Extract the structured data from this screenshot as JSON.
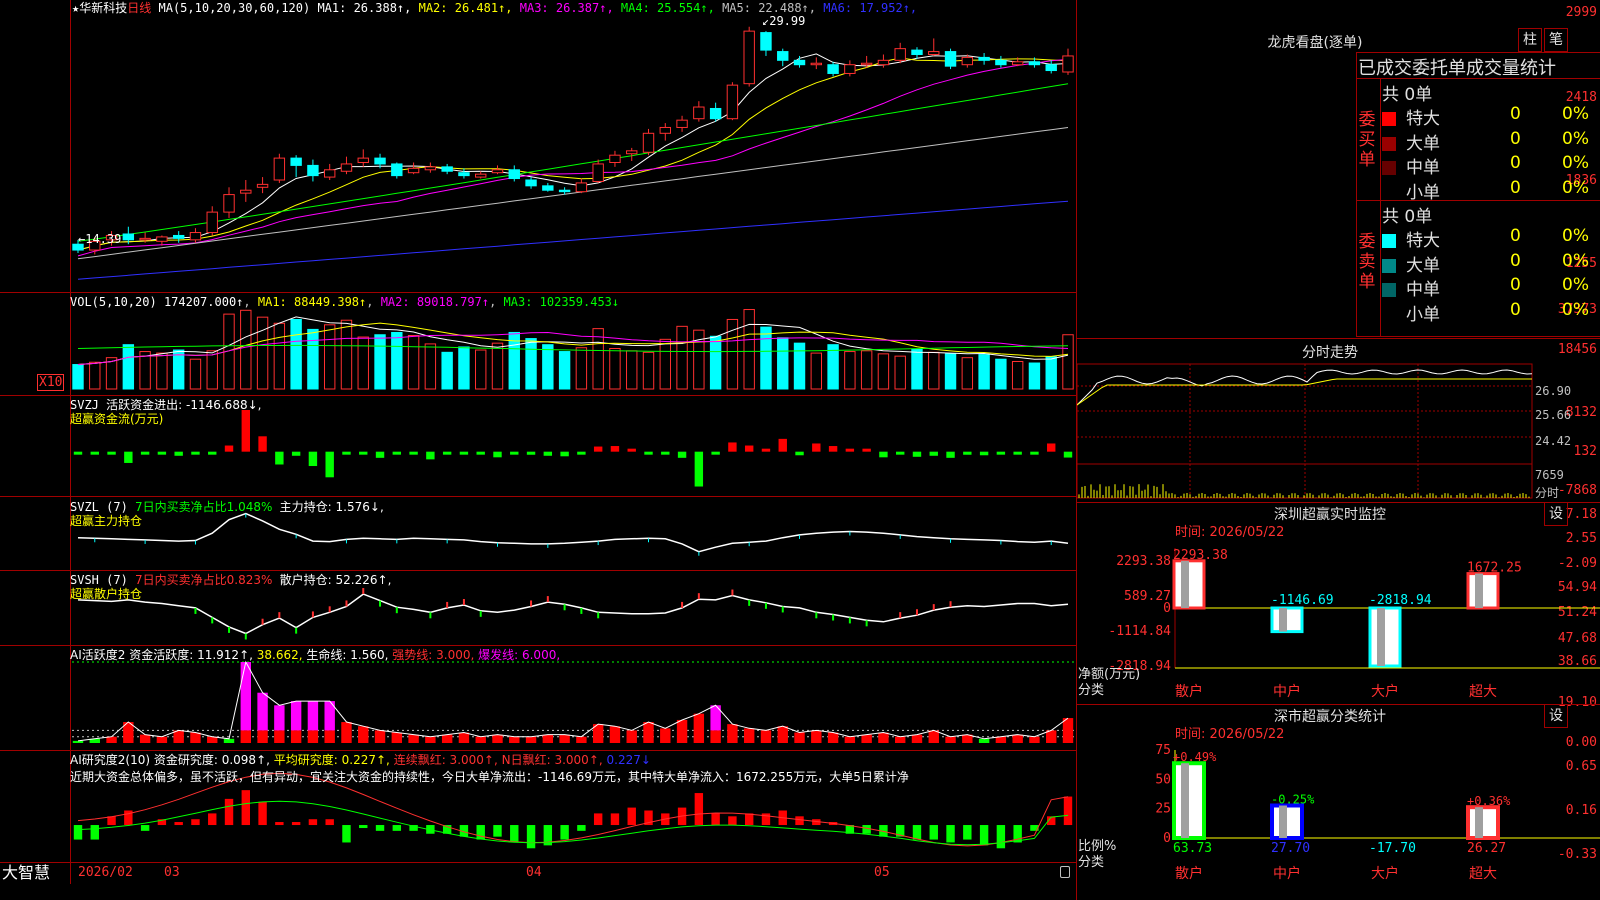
{
  "stock": {
    "star": "★",
    "name": "华新科技",
    "period": "日线"
  },
  "kline": {
    "ma_label": "MA(5,10,20,30,60,120)",
    "mas": [
      {
        "t": "MA1: 26.388↑",
        "c": "#ffffff"
      },
      {
        "t": "MA2: 26.481↑",
        "c": "#ffff00"
      },
      {
        "t": "MA3: 26.387↑",
        "c": "#ff00ff"
      },
      {
        "t": "MA4: 25.554↑",
        "c": "#00ff00"
      },
      {
        "t": "MA5: 22.488↑",
        "c": "#c0c0c0"
      },
      {
        "t": "MA6: 17.952↑",
        "c": "#3030ff"
      }
    ],
    "yticks": [
      "2999",
      "2418",
      "1836",
      "1255"
    ],
    "high_mark": "29.99",
    "low_mark": "14.39",
    "candles": [
      [
        15.0,
        14.6,
        15.3,
        14.4
      ],
      [
        14.6,
        15.2,
        15.5,
        14.3
      ],
      [
        15.3,
        15.6,
        15.9,
        14.9
      ],
      [
        15.7,
        15.3,
        16.2,
        15.0
      ],
      [
        15.3,
        15.4,
        15.8,
        15.1
      ],
      [
        15.2,
        15.5,
        15.6,
        14.9
      ],
      [
        15.6,
        15.4,
        15.9,
        15.1
      ],
      [
        15.3,
        15.8,
        16.1,
        15.1
      ],
      [
        15.8,
        17.2,
        17.6,
        15.6
      ],
      [
        17.2,
        18.4,
        18.9,
        16.8
      ],
      [
        18.5,
        18.7,
        19.4,
        17.9
      ],
      [
        18.9,
        19.1,
        19.6,
        18.5
      ],
      [
        19.4,
        20.9,
        21.2,
        19.2
      ],
      [
        20.9,
        20.4,
        21.1,
        19.6
      ],
      [
        20.4,
        19.7,
        20.8,
        19.3
      ],
      [
        19.6,
        20.1,
        20.5,
        19.4
      ],
      [
        20.0,
        20.5,
        21.0,
        19.8
      ],
      [
        20.6,
        20.9,
        21.5,
        20.3
      ],
      [
        20.9,
        20.5,
        21.2,
        20.2
      ],
      [
        20.5,
        19.7,
        20.6,
        19.5
      ],
      [
        19.9,
        20.2,
        20.6,
        19.8
      ],
      [
        20.1,
        20.3,
        20.6,
        19.9
      ],
      [
        20.3,
        20.0,
        20.5,
        19.8
      ],
      [
        19.9,
        19.7,
        20.2,
        19.5
      ],
      [
        19.6,
        19.8,
        20.0,
        19.5
      ],
      [
        19.9,
        20.1,
        20.4,
        19.8
      ],
      [
        20.1,
        19.5,
        20.4,
        19.3
      ],
      [
        19.4,
        19.0,
        19.6,
        18.8
      ],
      [
        19.0,
        18.7,
        19.2,
        18.6
      ],
      [
        18.7,
        18.6,
        18.9,
        18.4
      ],
      [
        18.6,
        19.2,
        19.5,
        18.5
      ],
      [
        19.3,
        20.5,
        20.8,
        19.2
      ],
      [
        20.6,
        21.1,
        21.4,
        20.3
      ],
      [
        21.2,
        21.4,
        21.6,
        20.7
      ],
      [
        21.3,
        22.6,
        22.9,
        21.1
      ],
      [
        22.6,
        23.0,
        23.3,
        22.1
      ],
      [
        23.0,
        23.5,
        23.8,
        22.7
      ],
      [
        23.6,
        24.4,
        24.8,
        23.4
      ],
      [
        24.3,
        23.6,
        24.7,
        23.4
      ],
      [
        23.6,
        25.9,
        26.1,
        23.5
      ],
      [
        26.0,
        29.6,
        29.9,
        25.8
      ],
      [
        29.5,
        28.3,
        29.6,
        27.9
      ],
      [
        28.2,
        27.6,
        28.4,
        27.2
      ],
      [
        27.6,
        27.3,
        27.9,
        27.1
      ],
      [
        27.3,
        27.4,
        27.8,
        27.0
      ],
      [
        27.3,
        26.7,
        27.5,
        26.5
      ],
      [
        26.7,
        27.3,
        27.6,
        26.5
      ],
      [
        27.3,
        27.4,
        27.9,
        27.1
      ],
      [
        27.3,
        27.6,
        28.0,
        27.1
      ],
      [
        27.6,
        28.4,
        28.8,
        27.4
      ],
      [
        28.3,
        28.0,
        28.5,
        27.7
      ],
      [
        28.0,
        28.2,
        29.1,
        27.9
      ],
      [
        28.2,
        27.2,
        28.4,
        27.0
      ],
      [
        27.3,
        27.8,
        28.0,
        27.1
      ],
      [
        27.8,
        27.6,
        28.1,
        27.3
      ],
      [
        27.6,
        27.3,
        27.9,
        27.1
      ],
      [
        27.3,
        27.5,
        27.8,
        27.2
      ],
      [
        27.5,
        27.3,
        27.8,
        27.1
      ],
      [
        27.3,
        26.9,
        27.6,
        26.7
      ],
      [
        26.8,
        27.9,
        28.4,
        26.6
      ]
    ]
  },
  "vol": {
    "label": "VOL(5,10,20)",
    "value": "174207.000↑",
    "ma1": "MA1: 88449.398↑",
    "ma2": "MA2: 89018.797↑",
    "ma3": "MA3: 102359.453↓",
    "yticks": [
      "37373",
      "18456"
    ],
    "unit": "X10",
    "bars": [
      3.2,
      3.5,
      4.1,
      5.8,
      4.9,
      4.7,
      5.1,
      3.9,
      5.0,
      9.8,
      10.3,
      9.4,
      8.6,
      9.1,
      7.8,
      8.4,
      9.0,
      6.8,
      7.1,
      7.4,
      7.0,
      5.9,
      4.8,
      5.5,
      5.1,
      6.0,
      7.4,
      6.6,
      5.8,
      4.9,
      5.4,
      7.9,
      5.3,
      5.0,
      4.8,
      6.5,
      8.2,
      7.7,
      6.9,
      9.1,
      10.4,
      8.1,
      6.7,
      6.0,
      4.7,
      5.8,
      4.9,
      5.0,
      4.6,
      4.3,
      5.2,
      4.8,
      4.6,
      4.1,
      4.5,
      3.9,
      3.6,
      3.4,
      4.2,
      7.1
    ]
  },
  "svzj": {
    "label": "SVZJ",
    "title": "活跃资金进出: -1146.688↓,",
    "sub": "超赢资金流(万元)",
    "yticks": [
      "8132",
      "132",
      "-7868"
    ],
    "values": [
      -200,
      -300,
      -100,
      -2200,
      -100,
      -200,
      -800,
      -400,
      -200,
      1200,
      8132,
      3000,
      -2500,
      -800,
      -2800,
      -5000,
      -300,
      -200,
      -1200,
      -300,
      -200,
      -1500,
      -400,
      -200,
      -300,
      -1100,
      -500,
      -600,
      -800,
      -900,
      -300,
      1000,
      1100,
      300,
      -300,
      -500,
      -1200,
      -6800,
      -300,
      1800,
      1200,
      200,
      2500,
      -700,
      1600,
      1100,
      300,
      400,
      -1100,
      -300,
      -1000,
      -800,
      -1200,
      -600,
      -700,
      -400,
      -500,
      -400,
      1600,
      -1146
    ]
  },
  "svzl": {
    "label": "SVZL (7)",
    "title": "7日内买卖净占比1.048%",
    "hold": "主力持仓: 1.576↓,",
    "sub": "超赢主力持仓",
    "yticks": [
      "7.18",
      "2.55",
      "-2.09"
    ],
    "values": [
      2.6,
      2.5,
      2.4,
      2.3,
      2.2,
      2.1,
      2.0,
      2.1,
      3.4,
      5.8,
      6.9,
      5.6,
      4.1,
      3.2,
      2.0,
      1.9,
      2.3,
      2.5,
      2.4,
      2.3,
      2.5,
      2.4,
      2.3,
      2.2,
      1.9,
      1.7,
      1.6,
      1.5,
      1.5,
      1.6,
      1.8,
      2.0,
      2.3,
      2.4,
      2.5,
      2.4,
      1.5,
      0.1,
      0.9,
      1.6,
      1.8,
      2.0,
      2.6,
      3.1,
      3.4,
      3.6,
      3.7,
      3.6,
      3.4,
      3.1,
      2.8,
      2.6,
      2.4,
      2.3,
      2.2,
      2.1,
      1.9,
      1.8,
      2.0,
      1.6
    ]
  },
  "svsh": {
    "label": "SVSH (7)",
    "title": "7日内买卖净占比0.823%",
    "hold": "散户持仓: 52.226↑,",
    "sub": "超赢散户持仓",
    "yticks": [
      "54.94",
      "51.24",
      "47.68"
    ],
    "values": [
      52.9,
      52.8,
      52.7,
      52.9,
      52.6,
      52.4,
      52.1,
      51.8,
      50.5,
      49.2,
      48.3,
      49.5,
      50.4,
      49.1,
      50.5,
      51.2,
      52.0,
      53.7,
      52.8,
      51.9,
      51.6,
      51.2,
      51.8,
      52.2,
      51.4,
      51.2,
      51.5,
      52.0,
      52.6,
      52.3,
      51.8,
      51.2,
      51.1,
      51.0,
      51.0,
      51.1,
      51.8,
      53.0,
      52.9,
      53.5,
      52.9,
      52.5,
      52.0,
      51.8,
      51.2,
      50.9,
      50.5,
      50.1,
      49.9,
      50.4,
      50.8,
      51.5,
      51.9,
      52.1,
      52.0,
      52.2,
      52.4,
      52.4,
      52.1,
      52.3
    ]
  },
  "ai1": {
    "label": "AI活跃度2",
    "t1": "资金活跃度: 11.912↑,",
    "t2": "38.662,",
    "t3": "生命线: 1.560,",
    "t4": "强势线: 3.000,",
    "t5": "爆发线: 6.000,",
    "yticks": [
      "38.66",
      "19.10",
      "0.00"
    ],
    "values": [
      1,
      2,
      3,
      10,
      4,
      3,
      6,
      5,
      3,
      2,
      38.66,
      24,
      18,
      20,
      20,
      20,
      10,
      8,
      6,
      5,
      4,
      3,
      4,
      5,
      3,
      4,
      3,
      3,
      4,
      4,
      3,
      9,
      8,
      6,
      10,
      7,
      11,
      14,
      18,
      9,
      7,
      6,
      8,
      5,
      6,
      5,
      3,
      4,
      5,
      3,
      4,
      6,
      3,
      4,
      2,
      3,
      4,
      3,
      6,
      11.9
    ]
  },
  "ai2": {
    "label": "AI研究度2(10)",
    "t1": "资金研究度: 0.098↑,",
    "t2": "平均研究度: 0.227↑,",
    "t3": "连续飘红: 3.000↑,",
    "t4": "N日飘红: 3.000↑,",
    "t5": "0.227↓",
    "yticks": [
      "0.65",
      "0.16",
      "-0.33"
    ],
    "note": "近期大资金总体偏多，虽不活跃，但有异动，宜关注大资金的持续性，今日大单净流出：-1146.69万元，其中特大单净流入：1672.255万元，大单5日累计净",
    "values": [
      -0.05,
      -0.05,
      0.03,
      0.05,
      -0.02,
      0.02,
      0.01,
      0.02,
      0.04,
      0.09,
      0.12,
      0.08,
      0.01,
      0.01,
      0.02,
      0.02,
      -0.06,
      -0.01,
      -0.02,
      -0.02,
      -0.02,
      -0.03,
      -0.03,
      -0.04,
      -0.05,
      -0.04,
      -0.06,
      -0.08,
      -0.07,
      -0.05,
      -0.02,
      0.04,
      0.04,
      0.06,
      0.05,
      0.04,
      0.06,
      0.11,
      0.04,
      0.03,
      0.04,
      0.04,
      0.05,
      0.03,
      0.02,
      0.01,
      -0.03,
      -0.03,
      -0.04,
      -0.04,
      -0.05,
      -0.05,
      -0.06,
      -0.05,
      -0.07,
      -0.08,
      -0.06,
      -0.02,
      0.03,
      0.098
    ]
  },
  "dates": {
    "d1": "2026/02",
    "d2": "03",
    "d3": "04",
    "d4": "05",
    "brand": "大智慧"
  },
  "lhb": {
    "title": "龙虎看盘(逐单)",
    "btn1": "柱",
    "btn2": "笔",
    "header": "已成交委托单成交量统计",
    "buy": {
      "side": "委买单",
      "total": "共 0单",
      "rows": [
        {
          "n": "特大",
          "c": "#ff0000",
          "v": "0",
          "p": "0%"
        },
        {
          "n": "大单",
          "c": "#990000",
          "v": "0",
          "p": "0%"
        },
        {
          "n": "中单",
          "c": "#660000",
          "v": "0",
          "p": "0%"
        },
        {
          "n": "小单",
          "c": "",
          "v": "0",
          "p": "0%"
        }
      ]
    },
    "sell": {
      "side": "委卖单",
      "total": "共 0单",
      "rows": [
        {
          "n": "特大",
          "c": "#00ffff",
          "v": "0",
          "p": "0%"
        },
        {
          "n": "大单",
          "c": "#008888",
          "v": "0",
          "p": "0%"
        },
        {
          "n": "中单",
          "c": "#006666",
          "v": "0",
          "p": "0%"
        },
        {
          "n": "小单",
          "c": "",
          "v": "0",
          "p": "0%"
        }
      ]
    }
  },
  "fs": {
    "title": "分时走势",
    "yticks": [
      "26.90",
      "25.66",
      "24.42"
    ],
    "vol_tick": "7659",
    "unit": "分时"
  },
  "sz": {
    "title": "深圳超赢实时监控",
    "btn": "设",
    "time": "时间: 2026/05/22",
    "yticks": [
      "2293.38",
      "589.27",
      "0",
      "-1114.84",
      "-2818.94"
    ],
    "ylabel": "净额(万元)",
    "xlabel": "分类",
    "cats": [
      {
        "n": "散户",
        "v": "2293.38",
        "val": 2293.38
      },
      {
        "n": "中户",
        "v": "-1146.69",
        "val": -1146.69
      },
      {
        "n": "大户",
        "v": "-2818.94",
        "val": -2818.94
      },
      {
        "n": "超大",
        "v": "1672.25",
        "val": 1672.25
      }
    ]
  },
  "ss": {
    "title": "深市超赢分类统计",
    "btn": "设",
    "time": "时间: 2026/05/22",
    "yticks": [
      "75",
      "50",
      "25",
      "0"
    ],
    "ylabel": "比例%",
    "xlabel": "分类",
    "cats": [
      {
        "n": "散户",
        "top": "+0.49%",
        "bot": "63.73",
        "val": 63.73
      },
      {
        "n": "中户",
        "top": "-0.25%",
        "bot": "27.70",
        "val": 27.7
      },
      {
        "n": "大户",
        "top": "",
        "bot": "-17.70",
        "val": 0
      },
      {
        "n": "超大",
        "top": "+0.36%",
        "bot": "26.27",
        "val": 26.27
      }
    ]
  }
}
